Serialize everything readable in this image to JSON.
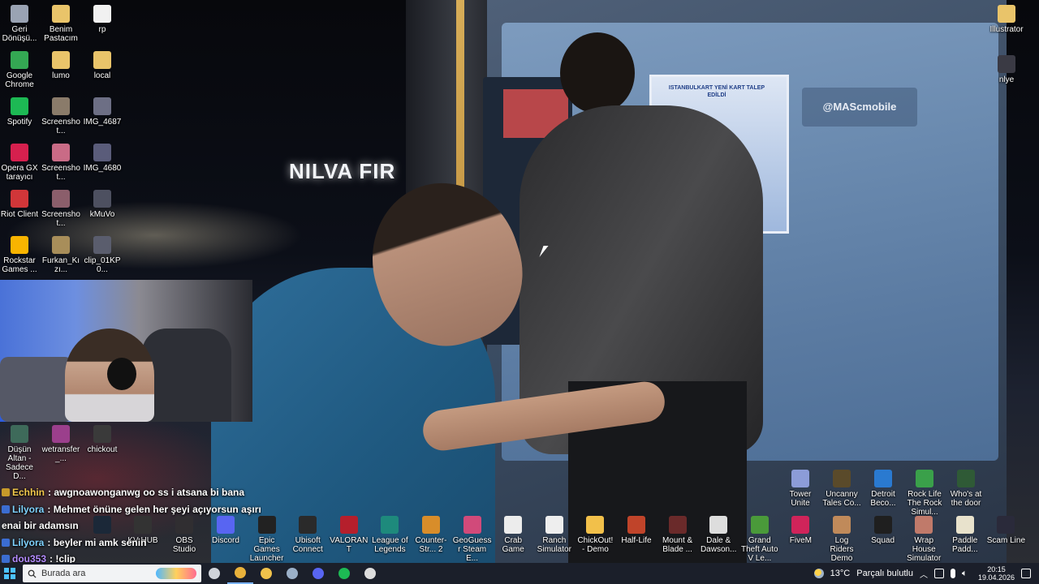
{
  "desktop": {
    "left_icons": [
      {
        "label": "Geri Dönüşü...",
        "icon": "recycle-bin-icon",
        "color": "#9aa3b3"
      },
      {
        "label": "Benim Pastacım",
        "icon": "folder-icon",
        "color": "#e9c46a"
      },
      {
        "label": "rp",
        "icon": "file-icon",
        "color": "#f1f1f1"
      },
      {
        "label": "Google Chrome",
        "icon": "chrome-icon",
        "color": "#34a853"
      },
      {
        "label": "lumo",
        "icon": "folder-icon",
        "color": "#e9c46a"
      },
      {
        "label": "local",
        "icon": "folder-icon",
        "color": "#e9c46a"
      },
      {
        "label": "Spotify",
        "icon": "spotify-icon",
        "color": "#1db954"
      },
      {
        "label": "Screenshot...",
        "icon": "image-icon",
        "color": "#8a7b6a"
      },
      {
        "label": "IMG_4687",
        "icon": "image-icon",
        "color": "#6d6f85"
      },
      {
        "label": "Opera GX tarayıcı",
        "icon": "opera-gx-icon",
        "color": "#d6204e"
      },
      {
        "label": "Screenshot...",
        "icon": "image-icon",
        "color": "#c96b86"
      },
      {
        "label": "IMG_4680",
        "icon": "image-icon",
        "color": "#5a5c7a"
      },
      {
        "label": "Riot Client",
        "icon": "riot-icon",
        "color": "#d13639"
      },
      {
        "label": "Screenshot...",
        "icon": "image-icon",
        "color": "#8b5e6b"
      },
      {
        "label": "kMuVo",
        "icon": "video-icon",
        "color": "#4d5060"
      },
      {
        "label": "Rockstar Games ...",
        "icon": "rockstar-icon",
        "color": "#f8b400"
      },
      {
        "label": "Furkan_Kızı...",
        "icon": "image-icon",
        "color": "#a88e5a"
      },
      {
        "label": "clip_01KP0...",
        "icon": "video-icon",
        "color": "#5a5d6d"
      }
    ],
    "mid_left_icons": [
      {
        "label": "Düşün Altan - Sadece D...",
        "icon": "video-icon",
        "color": "#3e6a5a"
      },
      {
        "label": "wetransfer_...",
        "icon": "winrar-icon",
        "color": "#9b3f8c"
      },
      {
        "label": "chickout",
        "icon": "game-icon",
        "color": "#3a3a3a"
      }
    ],
    "right_top_icons": [
      {
        "label": "Illustrator",
        "icon": "folder-icon",
        "color": "#e9c46a"
      },
      {
        "label": "nlye",
        "icon": "video-icon",
        "color": "#3a3a44"
      }
    ],
    "bottom_row_1": [
      {
        "label": "Tower Unite",
        "icon": "tower-unite-icon",
        "color": "#8c9cd8"
      },
      {
        "label": "Uncanny Tales Co...",
        "icon": "game-icon",
        "color": "#5a4a2a"
      },
      {
        "label": "Detroit Beco...",
        "icon": "detroit-icon",
        "color": "#2a7ad0"
      },
      {
        "label": "Rock Life The Rock Simul...",
        "icon": "game-icon",
        "color": "#3aa04a"
      },
      {
        "label": "Who's at the door",
        "icon": "game-icon",
        "color": "#2f5a36"
      }
    ],
    "bottom_row_2": [
      {
        "label": "Discord",
        "icon": "discord-icon",
        "color": "#5865f2"
      },
      {
        "label": "Epic Games Launcher",
        "icon": "epic-games-icon",
        "color": "#222222"
      },
      {
        "label": "Ubisoft Connect",
        "icon": "ubisoft-icon",
        "color": "#2a2a2a"
      },
      {
        "label": "VALORANT",
        "icon": "valorant-icon",
        "color": "#b51f2c"
      },
      {
        "label": "League of Legends",
        "icon": "league-icon",
        "color": "#1e8a7c"
      },
      {
        "label": "Counter-Str... 2",
        "icon": "cs2-icon",
        "color": "#d88d2a"
      },
      {
        "label": "GeoGuessr Steam E...",
        "icon": "geoguessr-icon",
        "color": "#d14a7a"
      },
      {
        "label": "Crab Game",
        "icon": "crab-game-icon",
        "color": "#ececec"
      },
      {
        "label": "Ranch Simulator",
        "icon": "ranch-icon",
        "color": "#eeeeee"
      },
      {
        "label": "ChickOut! - Demo",
        "icon": "chickout-icon",
        "color": "#f2c04a"
      },
      {
        "label": "Half-Life",
        "icon": "half-life-icon",
        "color": "#c0442a"
      },
      {
        "label": "Mount & Blade ...",
        "icon": "mount-blade-icon",
        "color": "#6a2a2a"
      },
      {
        "label": "Dale & Dawson...",
        "icon": "printer-icon",
        "color": "#dddddd"
      },
      {
        "label": "Grand Theft Auto V Le...",
        "icon": "gta-icon",
        "color": "#4a9a3a"
      },
      {
        "label": "FiveM",
        "icon": "fivem-icon",
        "color": "#d0245a"
      },
      {
        "label": "Log Riders Demo",
        "icon": "game-icon",
        "color": "#c08a5a"
      },
      {
        "label": "Squad",
        "icon": "squad-icon",
        "color": "#1f1f1f"
      },
      {
        "label": "Wrap House Simulator®...",
        "icon": "game-icon",
        "color": "#c07a6a"
      },
      {
        "label": "Paddle Padd...",
        "icon": "game-icon",
        "color": "#e8e2cc"
      },
      {
        "label": "Scam Line",
        "icon": "game-icon",
        "color": "#2a2a3a"
      }
    ],
    "partial_left_icons": [
      {
        "label": "Steam",
        "icon": "steam-icon",
        "color": "#1b2838"
      },
      {
        "label": "KV HUB",
        "icon": "kv-hub-icon",
        "color": "#333333"
      },
      {
        "label": "OBS Studio",
        "icon": "obs-icon",
        "color": "#302e31"
      }
    ]
  },
  "stream": {
    "sign_text": "NILVA  FIR",
    "poster_text": "ISTANBULKART YENİ KART TALEP EDİLDİ",
    "sticker_text": "@MAScmobile"
  },
  "chat": [
    {
      "user": "Echhin",
      "message": ": awgnoawonganwg oo ss i atsana bi bana",
      "user_color": "#f2c94c",
      "badge_color": "#c79a2a"
    },
    {
      "user": "Lilyora",
      "message": ": Mehmet önüne gelen her şeyi açıyorsun aşırı",
      "user_color": "#7fd3ff",
      "badge_color": "#3b6dd1"
    },
    {
      "user": "",
      "message": "enai bir adamsın",
      "user_color": "#ffffff",
      "badge_color": ""
    },
    {
      "user": "Lilyora",
      "message": ": beyler mi amk senin",
      "user_color": "#7fd3ff",
      "badge_color": "#3b6dd1"
    },
    {
      "user": "dou353",
      "message": ": !clip",
      "user_color": "#b48cff",
      "badge_color": "#3b6dd1"
    }
  ],
  "taskbar": {
    "search_text": "Burada ara",
    "apps": [
      {
        "name": "task-view-icon",
        "active": false
      },
      {
        "name": "chrome-icon",
        "active": true
      },
      {
        "name": "file-explorer-icon",
        "active": false
      },
      {
        "name": "steam-icon",
        "active": false
      },
      {
        "name": "discord-icon",
        "active": false
      },
      {
        "name": "spotify-icon",
        "active": false
      },
      {
        "name": "obs-icon",
        "active": false
      }
    ],
    "weather_temp": "13°C",
    "weather_desc": "Parçalı bulutlu",
    "time": "20:15",
    "date": "19.04.2026"
  },
  "colors": {
    "taskbar_bg": "#1b1f2a",
    "accent": "#7ab3ff"
  }
}
